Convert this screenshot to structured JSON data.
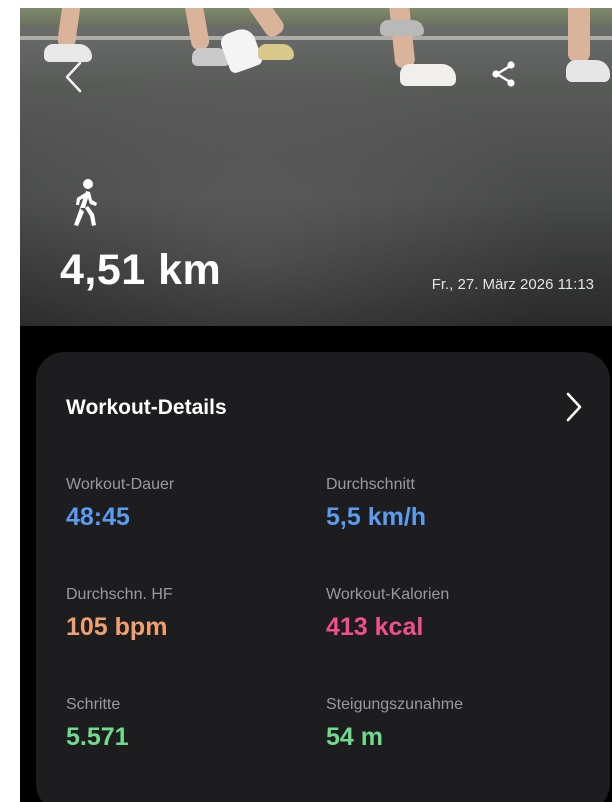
{
  "activity": {
    "distance": "4,51 km",
    "date": "Fr., 27. März 2026 11:13"
  },
  "icons": {
    "back": "chevron-left-icon",
    "share": "share-icon",
    "activity": "walking-person-icon",
    "details": "chevron-right-icon"
  },
  "details": {
    "title": "Workout-Details",
    "metrics": [
      {
        "label": "Workout-Dauer",
        "value": "48:45",
        "color": "#5b9bf0"
      },
      {
        "label": "Durchschnitt",
        "value": "5,5 km/h",
        "color": "#5b9bf0"
      },
      {
        "label": "Durchschn. HF",
        "value": "105 bpm",
        "color": "#f0a070"
      },
      {
        "label": "Workout-Kalorien",
        "value": "413 kcal",
        "color": "#f0508c"
      },
      {
        "label": "Schritte",
        "value": "5.571",
        "color": "#6fdc8c"
      },
      {
        "label": "Steigungszunahme",
        "value": "54 m",
        "color": "#6fdc8c"
      }
    ]
  }
}
